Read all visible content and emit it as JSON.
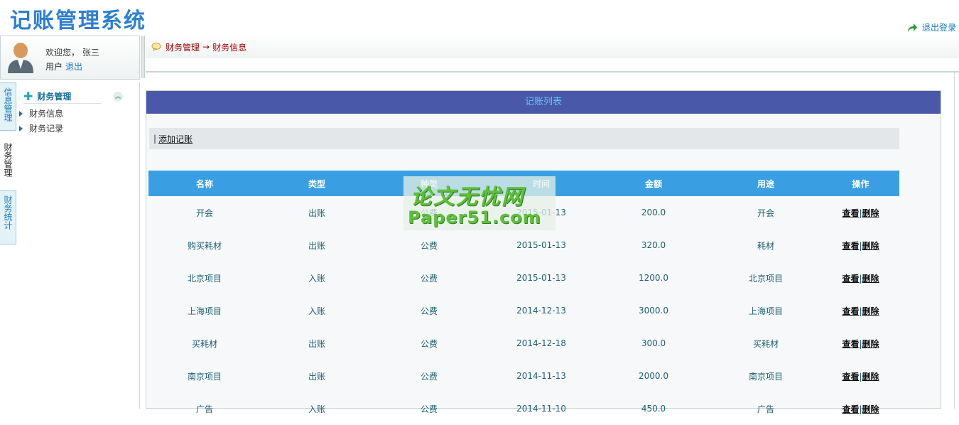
{
  "app": {
    "title": "记账管理系统",
    "logout_label": "退出登录"
  },
  "user": {
    "welcome": "欢迎您， 张三",
    "role": "用户",
    "exit_label": "退出"
  },
  "breadcrumb": {
    "first": "财务管理",
    "separator": "→",
    "second": "财务信息"
  },
  "vertical_tabs": [
    {
      "label": "信息管理"
    },
    {
      "label": "财务管理"
    },
    {
      "label": "财务统计"
    }
  ],
  "sidebar": {
    "section_title": "财务管理",
    "items": [
      {
        "label": "财务信息"
      },
      {
        "label": "财务记录"
      }
    ]
  },
  "panel": {
    "title": "记账列表",
    "toolbar_prefix": "|",
    "add_label": "添加记账"
  },
  "table": {
    "headers": [
      "名称",
      "类型",
      "种类",
      "时间",
      "金额",
      "用途",
      "操作"
    ],
    "view_label": "查看",
    "delete_label": "删除",
    "rows": [
      {
        "name": "开会",
        "type": "出账",
        "kind": "公费",
        "time": "2015-01-13",
        "amount": "200.0",
        "use": "开会"
      },
      {
        "name": "购买耗材",
        "type": "出账",
        "kind": "公费",
        "time": "2015-01-13",
        "amount": "320.0",
        "use": "耗材"
      },
      {
        "name": "北京项目",
        "type": "入账",
        "kind": "公费",
        "time": "2015-01-13",
        "amount": "1200.0",
        "use": "北京项目"
      },
      {
        "name": "上海项目",
        "type": "入账",
        "kind": "公费",
        "time": "2014-12-13",
        "amount": "3000.0",
        "use": "上海项目"
      },
      {
        "name": "买耗材",
        "type": "出账",
        "kind": "公费",
        "time": "2014-12-18",
        "amount": "300.0",
        "use": "买耗材"
      },
      {
        "name": "南京项目",
        "type": "出账",
        "kind": "公费",
        "time": "2014-11-13",
        "amount": "2000.0",
        "use": "南京项目"
      },
      {
        "name": "广告",
        "type": "入账",
        "kind": "公费",
        "time": "2014-11-10",
        "amount": "450.0",
        "use": "广告"
      }
    ]
  },
  "watermark": {
    "line1": "论文无忧网",
    "line2": "Paper51.com"
  }
}
